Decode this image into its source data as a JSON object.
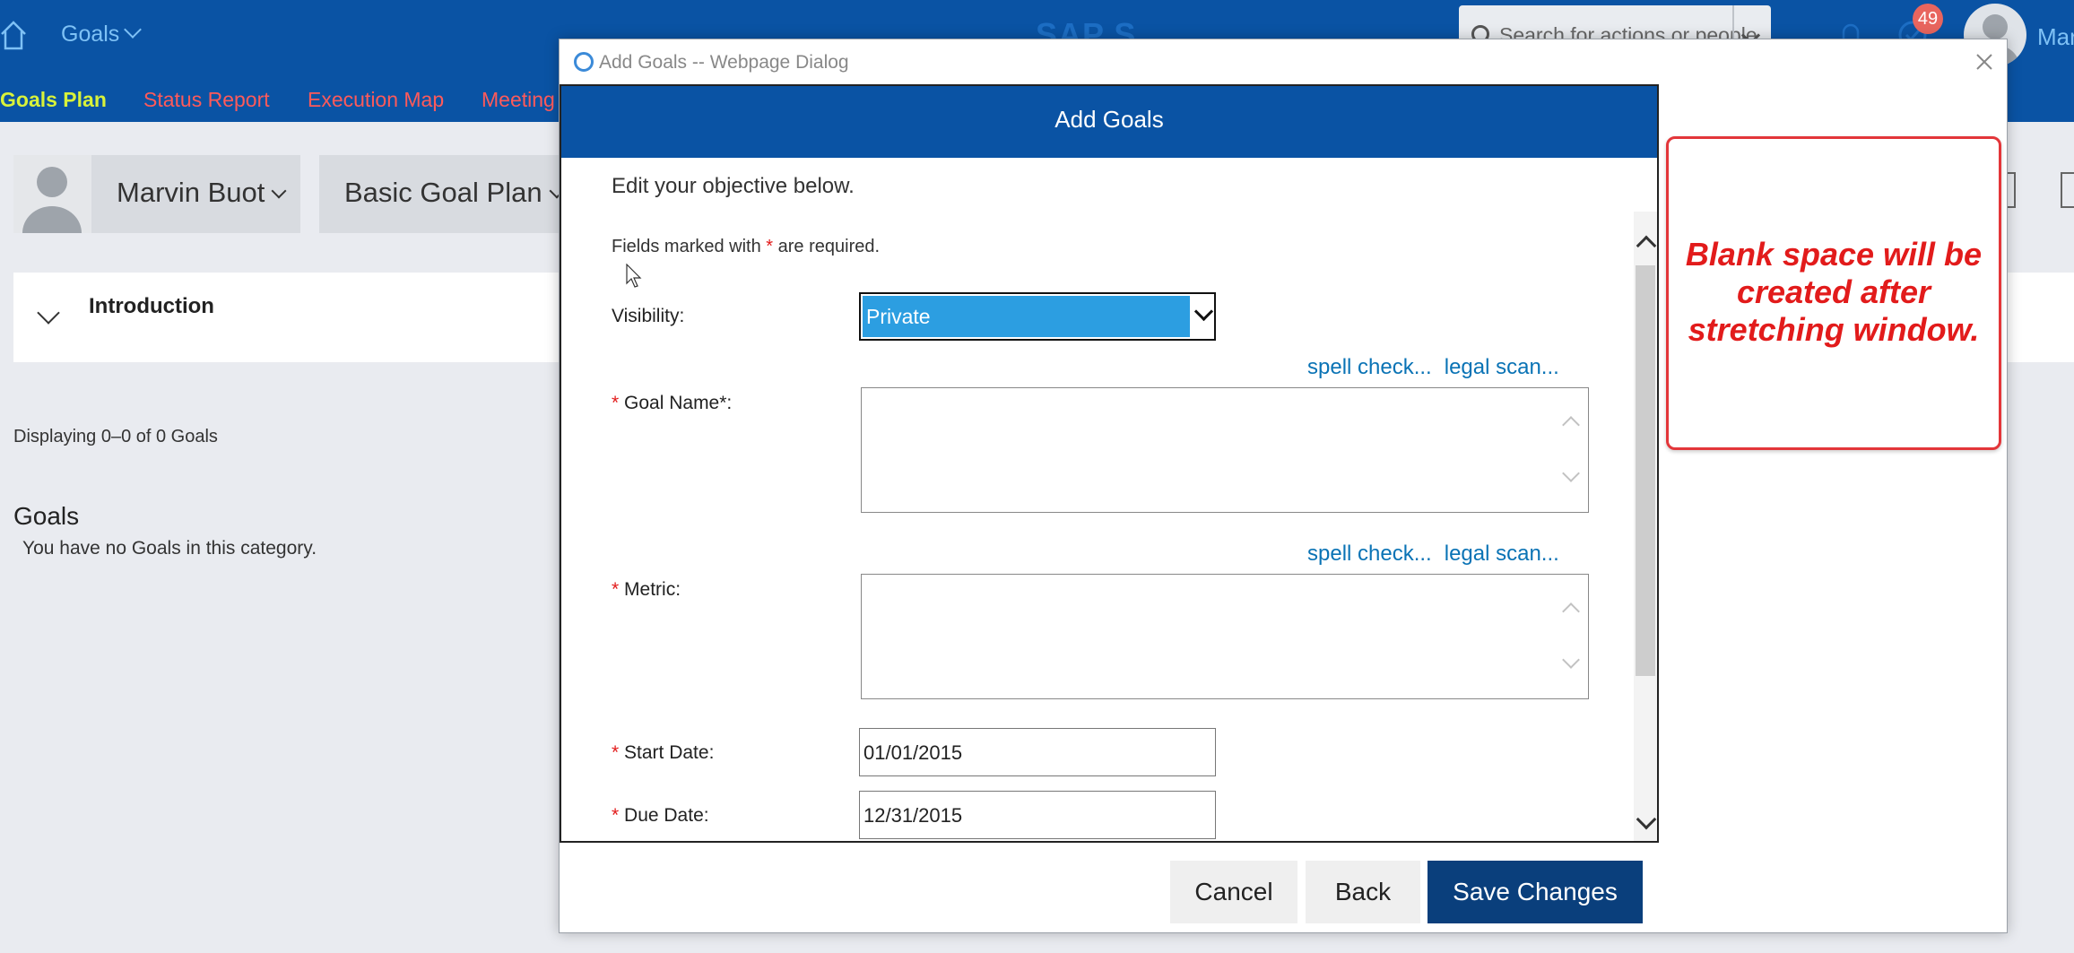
{
  "shell": {
    "menu_label": "Goals",
    "brand": "SAP S",
    "search_placeholder": "Search for actions or people",
    "notification_count": "49",
    "user_partial": "Mar"
  },
  "subnav": {
    "items": [
      "Goals Plan",
      "Status Report",
      "Execution Map",
      "Meeting"
    ]
  },
  "content": {
    "person_name": "Marvin Buot",
    "plan_name": "Basic Goal Plan",
    "intro_label": "Introduction",
    "displaying": "Displaying 0–0 of 0 Goals",
    "goals_heading": "Goals",
    "goals_empty": "You have no Goals in this category."
  },
  "dialog": {
    "window_title": "Add Goals -- Webpage Dialog",
    "header": "Add Goals",
    "edit_text": "Edit your objective below.",
    "required_prefix": "Fields marked with ",
    "required_star": "*",
    "required_suffix": " are required.",
    "visibility_label": "Visibility:",
    "visibility_value": "Private",
    "spell_check": "spell check...",
    "legal_scan": "legal scan...",
    "goal_name_label": "Goal Name*:",
    "metric_label": "Metric:",
    "start_date_label": "Start Date:",
    "start_date_value": "01/01/2015",
    "due_date_label": "Due Date:",
    "due_date_value": "12/31/2015",
    "cancel": "Cancel",
    "back": "Back",
    "save": "Save Changes"
  },
  "annotation": {
    "text": "Blank space will be created after stretching window."
  },
  "colors": {
    "shell_blue": "#0a53a4",
    "active_nav": "#d8f23a",
    "nav_link": "#ff5a5a",
    "required_red": "#e21b1b",
    "link_blue": "#0a73b5",
    "select_fill": "#2c9ee1",
    "primary_button": "#0a3f7c"
  }
}
